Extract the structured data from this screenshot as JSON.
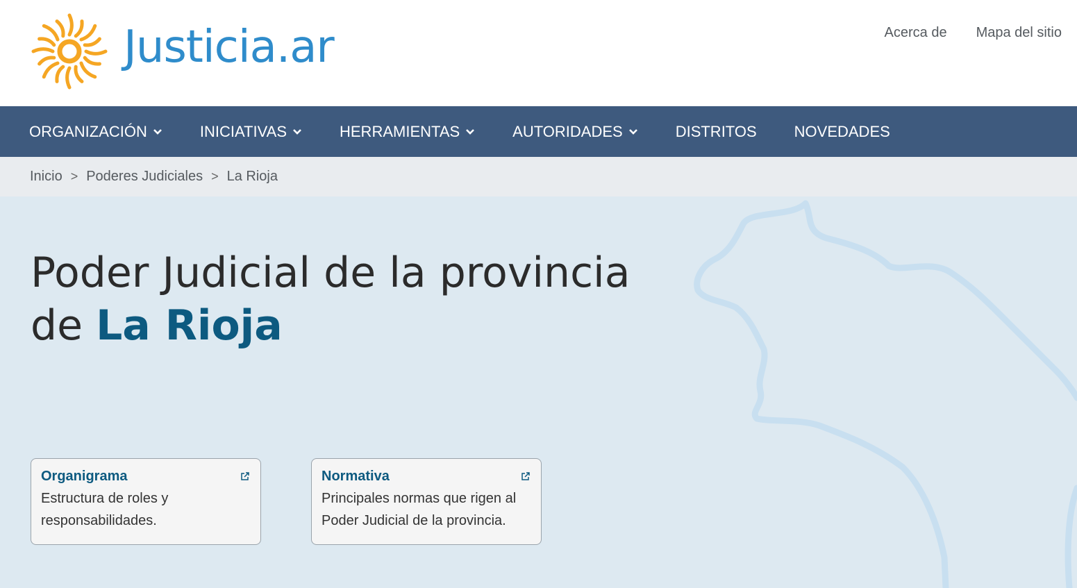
{
  "header": {
    "logo_name": "Justicia",
    "logo_domain": ".ar",
    "top_links": [
      "Acerca de",
      "Mapa del sitio"
    ]
  },
  "nav": {
    "items": [
      {
        "label": "ORGANIZACIÓN",
        "dropdown": true
      },
      {
        "label": "INICIATIVAS",
        "dropdown": true
      },
      {
        "label": "HERRAMIENTAS",
        "dropdown": true
      },
      {
        "label": "AUTORIDADES",
        "dropdown": true
      },
      {
        "label": "DISTRITOS",
        "dropdown": false
      },
      {
        "label": "NOVEDADES",
        "dropdown": false
      }
    ]
  },
  "breadcrumb": {
    "items": [
      "Inicio",
      "Poderes Judiciales",
      "La Rioja"
    ],
    "separator": ">"
  },
  "hero": {
    "title_line1": "Poder Judicial de la provincia",
    "title_line2_prefix": "de ",
    "title_highlight": "La Rioja"
  },
  "cards": [
    {
      "title": "Organigrama",
      "description": "Estructura de roles y responsabilidades."
    },
    {
      "title": "Normativa",
      "description": "Principales normas que rigen al Poder Judicial de la provincia."
    }
  ],
  "colors": {
    "nav_bg": "#3e5a7e",
    "logo_blue": "#2f8ccb",
    "sun_orange": "#f5a623",
    "hero_bg": "#dde9f1",
    "accent_dark_blue": "#0d5a80"
  }
}
